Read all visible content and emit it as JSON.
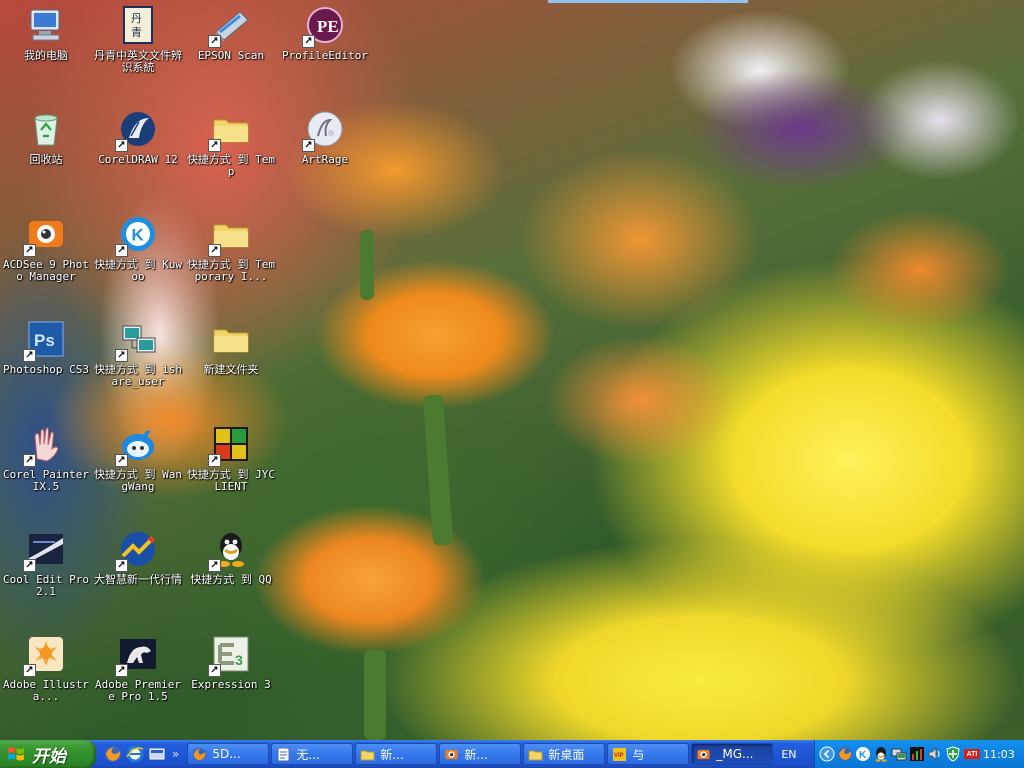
{
  "desktop": {
    "icons": [
      {
        "label": "我的电脑",
        "icon": "my-computer-icon",
        "shortcut": false
      },
      {
        "label": "回收站",
        "icon": "recycle-bin-icon",
        "shortcut": false
      },
      {
        "label": "ACDSee 9 Photo Manager",
        "icon": "acdsee-icon",
        "shortcut": true
      },
      {
        "label": "Photoshop CS3",
        "icon": "photoshop-icon",
        "shortcut": true
      },
      {
        "label": "Corel Painter IX.5",
        "icon": "corel-painter-icon",
        "shortcut": true
      },
      {
        "label": "Cool Edit Pro 2.1",
        "icon": "cool-edit-icon",
        "shortcut": true
      },
      {
        "label": "Adobe Illustra...",
        "icon": "illustrator-icon",
        "shortcut": true
      },
      {
        "label": "丹青中英文文件辨识系統",
        "icon": "danqing-icon",
        "shortcut": false
      },
      {
        "label": "CorelDRAW 12",
        "icon": "coreldraw-icon",
        "shortcut": true
      },
      {
        "label": "快捷方式 到 Kuwoo",
        "icon": "kuwoo-icon",
        "shortcut": true
      },
      {
        "label": "快捷方式 到 ishare_user",
        "icon": "ishare-icon",
        "shortcut": true
      },
      {
        "label": "快捷方式 到 WangWang",
        "icon": "wangwang-icon",
        "shortcut": true
      },
      {
        "label": "大智慧新一代行情",
        "icon": "dazhihui-icon",
        "shortcut": true
      },
      {
        "label": "Adobe Premiere Pro 1.5",
        "icon": "premiere-icon",
        "shortcut": true
      },
      {
        "label": "EPSON Scan",
        "icon": "epson-scan-icon",
        "shortcut": true
      },
      {
        "label": "快捷方式 到 Temp",
        "icon": "folder-temp-icon",
        "shortcut": true
      },
      {
        "label": "快捷方式 到 Temporary I...",
        "icon": "folder-temporary-icon",
        "shortcut": true
      },
      {
        "label": "新建文件夹",
        "icon": "new-folder-icon",
        "shortcut": false
      },
      {
        "label": "快捷方式 到 JYCLIENT",
        "icon": "jyclient-icon",
        "shortcut": true
      },
      {
        "label": "快捷方式 到 QQ",
        "icon": "qq-icon",
        "shortcut": true
      },
      {
        "label": "Expression 3",
        "icon": "expression-icon",
        "shortcut": true
      },
      {
        "label": "ProfileEditor",
        "icon": "profile-editor-icon",
        "shortcut": true
      },
      {
        "label": "ArtRage",
        "icon": "artrage-icon",
        "shortcut": true
      }
    ]
  },
  "taskbar": {
    "start_label": "开始",
    "quick_launch": [
      "firefox-icon",
      "ie-icon",
      "show-desktop-icon"
    ],
    "quick_launch_more": "»",
    "buttons": [
      {
        "label": "5D...",
        "icon": "firefox-icon",
        "active": false
      },
      {
        "label": "无...",
        "icon": "document-icon",
        "active": false
      },
      {
        "label": "新...",
        "icon": "folder-icon",
        "active": false
      },
      {
        "label": "新...",
        "icon": "acdsee-icon",
        "active": false
      },
      {
        "label": "新桌面",
        "icon": "folder-icon",
        "active": false
      },
      {
        "label": "与",
        "icon": "vip-icon",
        "active": false
      },
      {
        "label": "_MG...",
        "icon": "acdsee-icon",
        "active": true
      }
    ],
    "language": "EN",
    "tray_icons": [
      "tray-expand-icon",
      "firefox-tray-icon",
      "kuwoo-tray-icon",
      "qq-tray-icon",
      "network-tray-icon",
      "stock-tray-icon",
      "speaker-tray-icon",
      "shield-tray-icon",
      "ati-tray-icon"
    ],
    "ati_label": "ATI",
    "clock": "11:03"
  },
  "colors": {
    "taskbar_blue": "#245edb",
    "start_green": "#3c9b35",
    "tray_blue": "#0e84e4"
  }
}
